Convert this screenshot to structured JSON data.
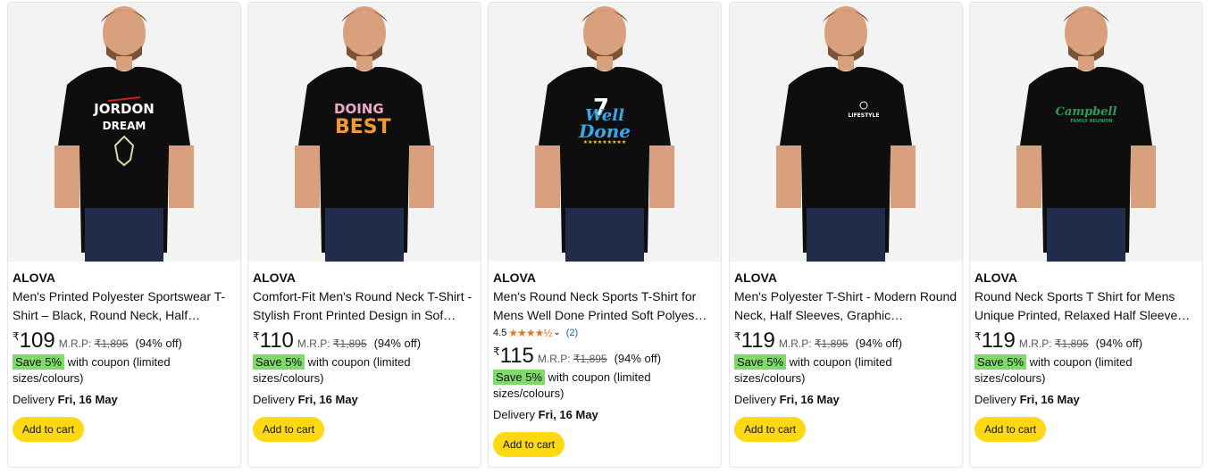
{
  "products": [
    {
      "brand": "ALOVA",
      "title": "Men's Printed Polyester Sportswear T-Shirt – Black, Round Neck, Half…",
      "currency": "₹",
      "price": "109",
      "mrp_label": "M.R.P:",
      "mrp": "₹1,895",
      "discount": "(94% off)",
      "save_badge": "Save 5%",
      "coupon_text": "with coupon (limited sizes/colours)",
      "delivery_label": "Delivery",
      "delivery_date": "Fri, 16 May",
      "cart_label": "Add to cart",
      "print_line1": "JORDON",
      "print_line2": "DREAM"
    },
    {
      "brand": "ALOVA",
      "title": "Comfort-Fit Men's Round Neck T-Shirt - Stylish Front Printed Design in Sof…",
      "currency": "₹",
      "price": "110",
      "mrp_label": "M.R.P:",
      "mrp": "₹1,895",
      "discount": "(94% off)",
      "save_badge": "Save 5%",
      "coupon_text": "with coupon (limited sizes/colours)",
      "delivery_label": "Delivery",
      "delivery_date": "Fri, 16 May",
      "cart_label": "Add to cart",
      "print_line1": "DOING",
      "print_line2": "BEST"
    },
    {
      "brand": "ALOVA",
      "title": "Men's Round Neck Sports T-Shirt for Mens Well Done Printed Soft Polyes…",
      "rating_value": "4.5",
      "rating_stars": "★★★★½",
      "rating_count": "(2)",
      "currency": "₹",
      "price": "115",
      "mrp_label": "M.R.P:",
      "mrp": "₹1,895",
      "discount": "(94% off)",
      "save_badge": "Save 5%",
      "coupon_text": "with coupon (limited sizes/colours)",
      "delivery_label": "Delivery",
      "delivery_date": "Fri, 16 May",
      "cart_label": "Add to cart",
      "print_line1": "Well",
      "print_line2": "Done"
    },
    {
      "brand": "ALOVA",
      "title": "Men's Polyester T-Shirt - Modern Round Neck, Half Sleeves, Graphic…",
      "currency": "₹",
      "price": "119",
      "mrp_label": "M.R.P:",
      "mrp": "₹1,895",
      "discount": "(94% off)",
      "save_badge": "Save 5%",
      "coupon_text": "with coupon (limited sizes/colours)",
      "delivery_label": "Delivery",
      "delivery_date": "Fri, 16 May",
      "cart_label": "Add to cart",
      "print_line1": "LIFESTYLE",
      "print_line2": ""
    },
    {
      "brand": "ALOVA",
      "title": "Round Neck Sports T Shirt for Mens Unique Printed, Relaxed Half Sleeve…",
      "currency": "₹",
      "price": "119",
      "mrp_label": "M.R.P:",
      "mrp": "₹1,895",
      "discount": "(94% off)",
      "save_badge": "Save 5%",
      "coupon_text": "with coupon (limited sizes/colours)",
      "delivery_label": "Delivery",
      "delivery_date": "Fri, 16 May",
      "cart_label": "Add to cart",
      "print_line1": "Campbell",
      "print_line2": "FAMILY REUNION"
    }
  ],
  "colors": {
    "cart_button": "#ffd814",
    "save_badge": "#7fda69",
    "star": "#de7921",
    "link": "#2162a1"
  }
}
